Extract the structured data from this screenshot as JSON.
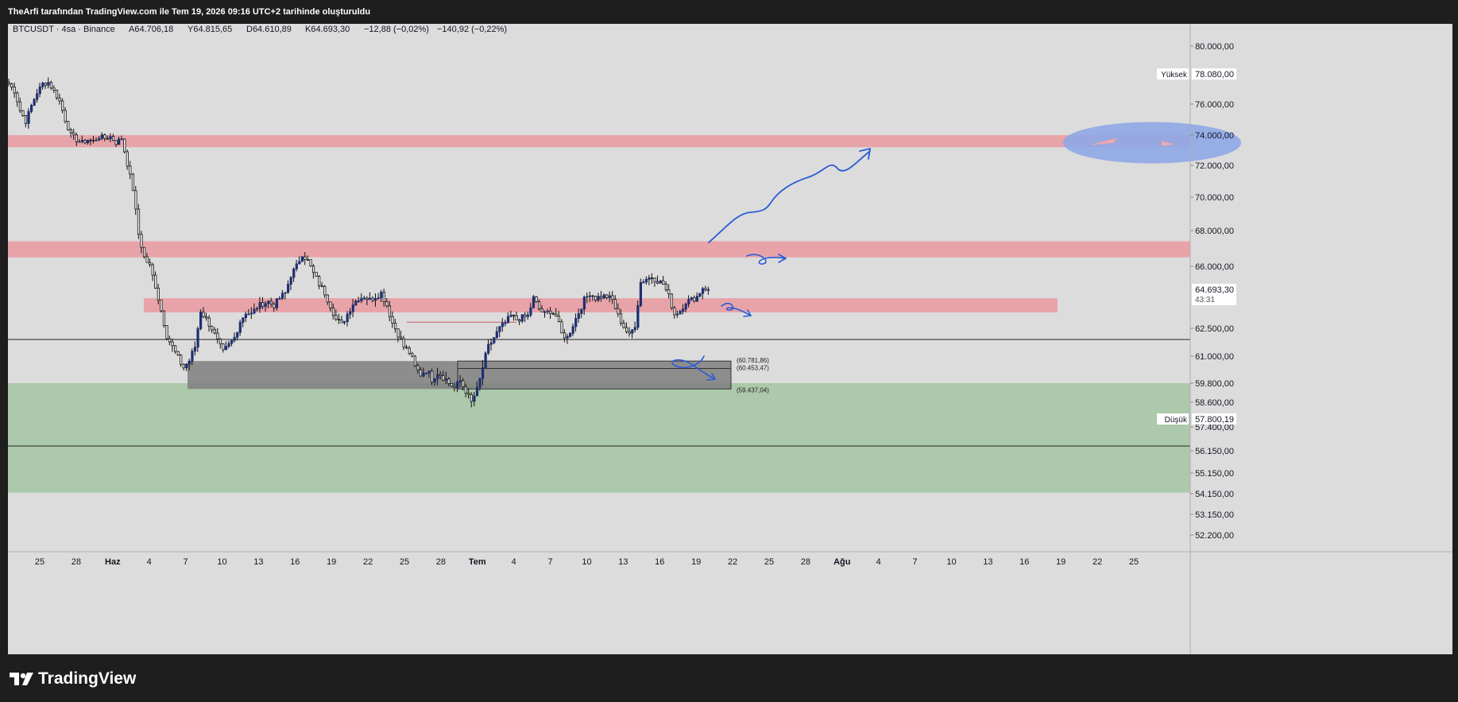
{
  "header": {
    "caption": "TheArfi tarafından TradingView.com ile Tem 19, 2026 09:16 UTC+2 tarihinde oluşturuldu"
  },
  "chart_info": {
    "symbol_line": "BTCUSDT · 4sa · Binance",
    "ohlc": {
      "open": "A64.706,18",
      "high": "Y64.815,65",
      "low": "D64.610,89",
      "close": "K64.693,30",
      "change": "−12,88 (−0,02%)",
      "change2": "−140,92 (−0,22%)"
    }
  },
  "brand": {
    "logo_text": "TradingView"
  },
  "colors": {
    "chart_bg": "#dcdcdc",
    "resistance_zone": "#e8a3a9",
    "support_zone": "#acc9ab",
    "consolidation_box": "#7f7f7f",
    "arrow_blue": "#2a5bd7",
    "ellipse_blue": "#8ea7e6",
    "candle_up": "#1d2f73",
    "candle_down": "#111111"
  },
  "chart_data": {
    "type": "candlestick",
    "price_axis": {
      "ticks": [
        "80.000,00",
        "76.000,00",
        "74.000,00",
        "72.000,00",
        "70.000,00",
        "68.000,00",
        "66.000,00",
        "62.500,00",
        "61.000,00",
        "59.800,00",
        "58.600,00",
        "57.400,00",
        "56.150,00",
        "55.150,00",
        "54.150,00",
        "53.150,00",
        "52.200,00"
      ],
      "high_label": "Yüksek",
      "high_value": "78.080,00",
      "low_label": "Düşük",
      "low_value": "57.800,19",
      "last_price": "64.693,30",
      "countdown": "43:31"
    },
    "time_axis": {
      "ticks": [
        "25",
        "28",
        "Haz",
        "4",
        "7",
        "10",
        "13",
        "16",
        "19",
        "22",
        "25",
        "28",
        "Tem",
        "4",
        "7",
        "10",
        "13",
        "16",
        "19",
        "22",
        "25",
        "28",
        "Ağu",
        "4",
        "7",
        "10",
        "13",
        "16",
        "19",
        "22",
        "25"
      ],
      "bold_ticks": [
        "Haz",
        "Tem",
        "Ağu"
      ]
    },
    "zones": [
      {
        "kind": "resistance",
        "low": 73.2,
        "high": 74.0
      },
      {
        "kind": "resistance",
        "low": 66.5,
        "high": 67.4
      },
      {
        "kind": "resistance",
        "low": 63.4,
        "high": 64.2
      },
      {
        "kind": "support",
        "low": 54.2,
        "high": 59.8
      },
      {
        "kind": "consolidation",
        "low": 59.437,
        "high": 60.782
      }
    ],
    "horizontal_lines": [
      61.9,
      56.4
    ],
    "box_labels": [
      "(60.781,86)",
      "(60.453,47)",
      "(59.437,04)"
    ],
    "path_points": [
      [
        0,
        77.4
      ],
      [
        2,
        76.9
      ],
      [
        4,
        75.6
      ],
      [
        6,
        74.9
      ],
      [
        8,
        75.9
      ],
      [
        10,
        76.8
      ],
      [
        12,
        77.4
      ],
      [
        14,
        77.5
      ],
      [
        16,
        76.9
      ],
      [
        18,
        76.2
      ],
      [
        20,
        75.0
      ],
      [
        22,
        74.0
      ],
      [
        24,
        73.7
      ],
      [
        26,
        73.5
      ],
      [
        28,
        73.7
      ],
      [
        30,
        73.6
      ],
      [
        32,
        73.9
      ],
      [
        34,
        73.8
      ],
      [
        36,
        73.9
      ],
      [
        38,
        73.5
      ],
      [
        40,
        73.8
      ],
      [
        42,
        72.1
      ],
      [
        44,
        70.5
      ],
      [
        46,
        67.8
      ],
      [
        48,
        66.5
      ],
      [
        50,
        66.0
      ],
      [
        52,
        64.9
      ],
      [
        54,
        63.5
      ],
      [
        56,
        62.1
      ],
      [
        58,
        61.5
      ],
      [
        60,
        60.9
      ],
      [
        62,
        60.5
      ],
      [
        64,
        60.8
      ],
      [
        66,
        61.5
      ],
      [
        68,
        63.5
      ],
      [
        70,
        63.0
      ],
      [
        72,
        62.5
      ],
      [
        74,
        61.8
      ],
      [
        76,
        61.2
      ],
      [
        78,
        61.6
      ],
      [
        80,
        62.0
      ],
      [
        82,
        62.9
      ],
      [
        84,
        63.4
      ],
      [
        86,
        63.3
      ],
      [
        88,
        63.7
      ],
      [
        90,
        63.9
      ],
      [
        92,
        64.0
      ],
      [
        94,
        63.8
      ],
      [
        96,
        64.2
      ],
      [
        98,
        64.5
      ],
      [
        100,
        65.5
      ],
      [
        102,
        66.0
      ],
      [
        104,
        66.7
      ],
      [
        106,
        66.3
      ],
      [
        108,
        65.6
      ],
      [
        110,
        65.0
      ],
      [
        112,
        64.5
      ],
      [
        114,
        63.8
      ],
      [
        116,
        63.0
      ],
      [
        118,
        62.7
      ],
      [
        120,
        63.3
      ],
      [
        122,
        63.9
      ],
      [
        124,
        64.2
      ],
      [
        126,
        64.3
      ],
      [
        128,
        64.1
      ],
      [
        130,
        64.3
      ],
      [
        132,
        64.5
      ],
      [
        134,
        63.8
      ],
      [
        136,
        62.8
      ],
      [
        138,
        62.2
      ],
      [
        140,
        61.5
      ],
      [
        142,
        61.2
      ],
      [
        144,
        60.5
      ],
      [
        146,
        60.2
      ],
      [
        148,
        60.4
      ],
      [
        150,
        60.0
      ],
      [
        152,
        60.3
      ],
      [
        154,
        60.1
      ],
      [
        156,
        59.8
      ],
      [
        158,
        59.5
      ],
      [
        160,
        59.9
      ],
      [
        162,
        59.3
      ],
      [
        164,
        58.6
      ],
      [
        166,
        59.4
      ],
      [
        168,
        60.5
      ],
      [
        170,
        61.5
      ],
      [
        172,
        62.0
      ],
      [
        174,
        62.5
      ],
      [
        176,
        62.8
      ],
      [
        178,
        63.2
      ],
      [
        180,
        63.0
      ],
      [
        182,
        63.1
      ],
      [
        184,
        63.2
      ],
      [
        186,
        64.2
      ],
      [
        188,
        63.6
      ],
      [
        190,
        63.3
      ],
      [
        192,
        63.5
      ],
      [
        194,
        63.2
      ],
      [
        196,
        62.2
      ],
      [
        198,
        62.0
      ],
      [
        200,
        62.7
      ],
      [
        202,
        63.4
      ],
      [
        204,
        64.1
      ],
      [
        206,
        64.5
      ],
      [
        208,
        64.2
      ],
      [
        210,
        64.3
      ],
      [
        212,
        64.3
      ],
      [
        214,
        64.1
      ],
      [
        216,
        63.2
      ],
      [
        218,
        62.6
      ],
      [
        220,
        62.1
      ],
      [
        222,
        62.7
      ],
      [
        224,
        65.1
      ],
      [
        226,
        65.3
      ],
      [
        228,
        65.4
      ],
      [
        230,
        65.2
      ],
      [
        232,
        65.0
      ],
      [
        234,
        64.3
      ],
      [
        236,
        63.3
      ],
      [
        238,
        63.5
      ],
      [
        240,
        64.0
      ],
      [
        242,
        64.1
      ],
      [
        244,
        64.3
      ],
      [
        246,
        64.8
      ],
      [
        248,
        64.69
      ]
    ]
  }
}
